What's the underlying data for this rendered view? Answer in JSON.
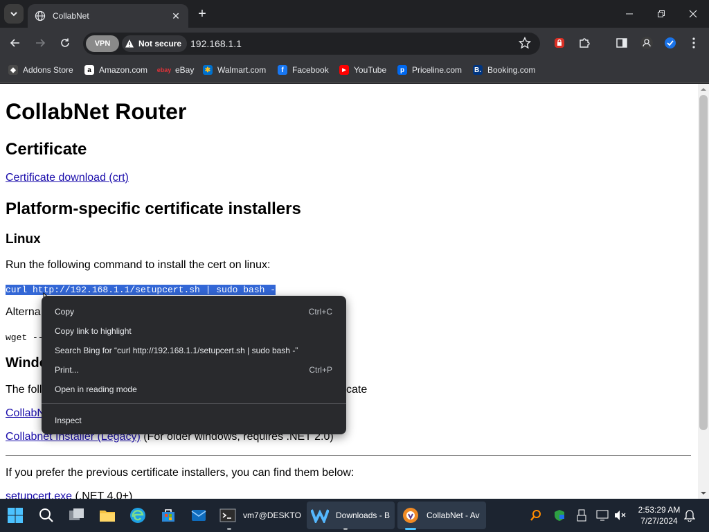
{
  "browser": {
    "tab_title": "CollabNet",
    "vpn_label": "VPN",
    "security_label": "Not secure",
    "url": "192.168.1.1",
    "bookmarks": [
      {
        "label": "Addons Store",
        "color": "#5f6368"
      },
      {
        "label": "Amazon.com",
        "color": "#ffffff"
      },
      {
        "label": "eBay",
        "color": "#e53238"
      },
      {
        "label": "Walmart.com",
        "color": "#0071ce"
      },
      {
        "label": "Facebook",
        "color": "#1877f2"
      },
      {
        "label": "YouTube",
        "color": "#ff0000"
      },
      {
        "label": "Priceline.com",
        "color": "#0068ef"
      },
      {
        "label": "Booking.com",
        "color": "#003580"
      }
    ]
  },
  "page": {
    "h1": "CollabNet Router",
    "h2_certificate": "Certificate",
    "cert_link": "Certificate download (crt)",
    "h2_installers": "Platform-specific certificate installers",
    "h3_linux": "Linux",
    "linux_instruction": "Run the following command to install the cert on linux:",
    "curl_command": "curl http://192.168.1.1/setupcert.sh | sudo bash -",
    "alt_partial": "Alterna",
    "wget_partial": "wget --",
    "windows_partial": "Windo",
    "following_partial": "The foll",
    "following_tail": "cate",
    "collab_link_partial": "CollabN",
    "legacy_link": "Collabnet Installer (Legacy)",
    "legacy_note": " (For older windows, requires .NET 2.0)",
    "previous_text": "If you prefer the previous certificate installers, you can find them below:",
    "setupcert_link": "setupcert.exe",
    "setupcert_note": " (.NET 4.0+)"
  },
  "context_menu": {
    "items": [
      {
        "label": "Copy",
        "shortcut": "Ctrl+C"
      },
      {
        "label": "Copy link to highlight",
        "shortcut": ""
      },
      {
        "label": "Search Bing for “curl http://192.168.1.1/setupcert.sh | sudo bash -”",
        "shortcut": ""
      },
      {
        "label": "Print...",
        "shortcut": "Ctrl+P"
      },
      {
        "label": "Open in reading mode",
        "shortcut": ""
      },
      {
        "label": "Inspect",
        "shortcut": ""
      }
    ]
  },
  "taskbar": {
    "apps": [
      {
        "label": "vm7@DESKTO"
      },
      {
        "label": "Downloads - B"
      },
      {
        "label": "CollabNet - Av"
      }
    ],
    "time": "2:53:29 AM",
    "date": "7/27/2024"
  },
  "colors": {
    "selection": "#3367d6",
    "link": "#1a0dab",
    "menu_bg": "#292a2d",
    "taskbar_bg": "#1c2430"
  }
}
